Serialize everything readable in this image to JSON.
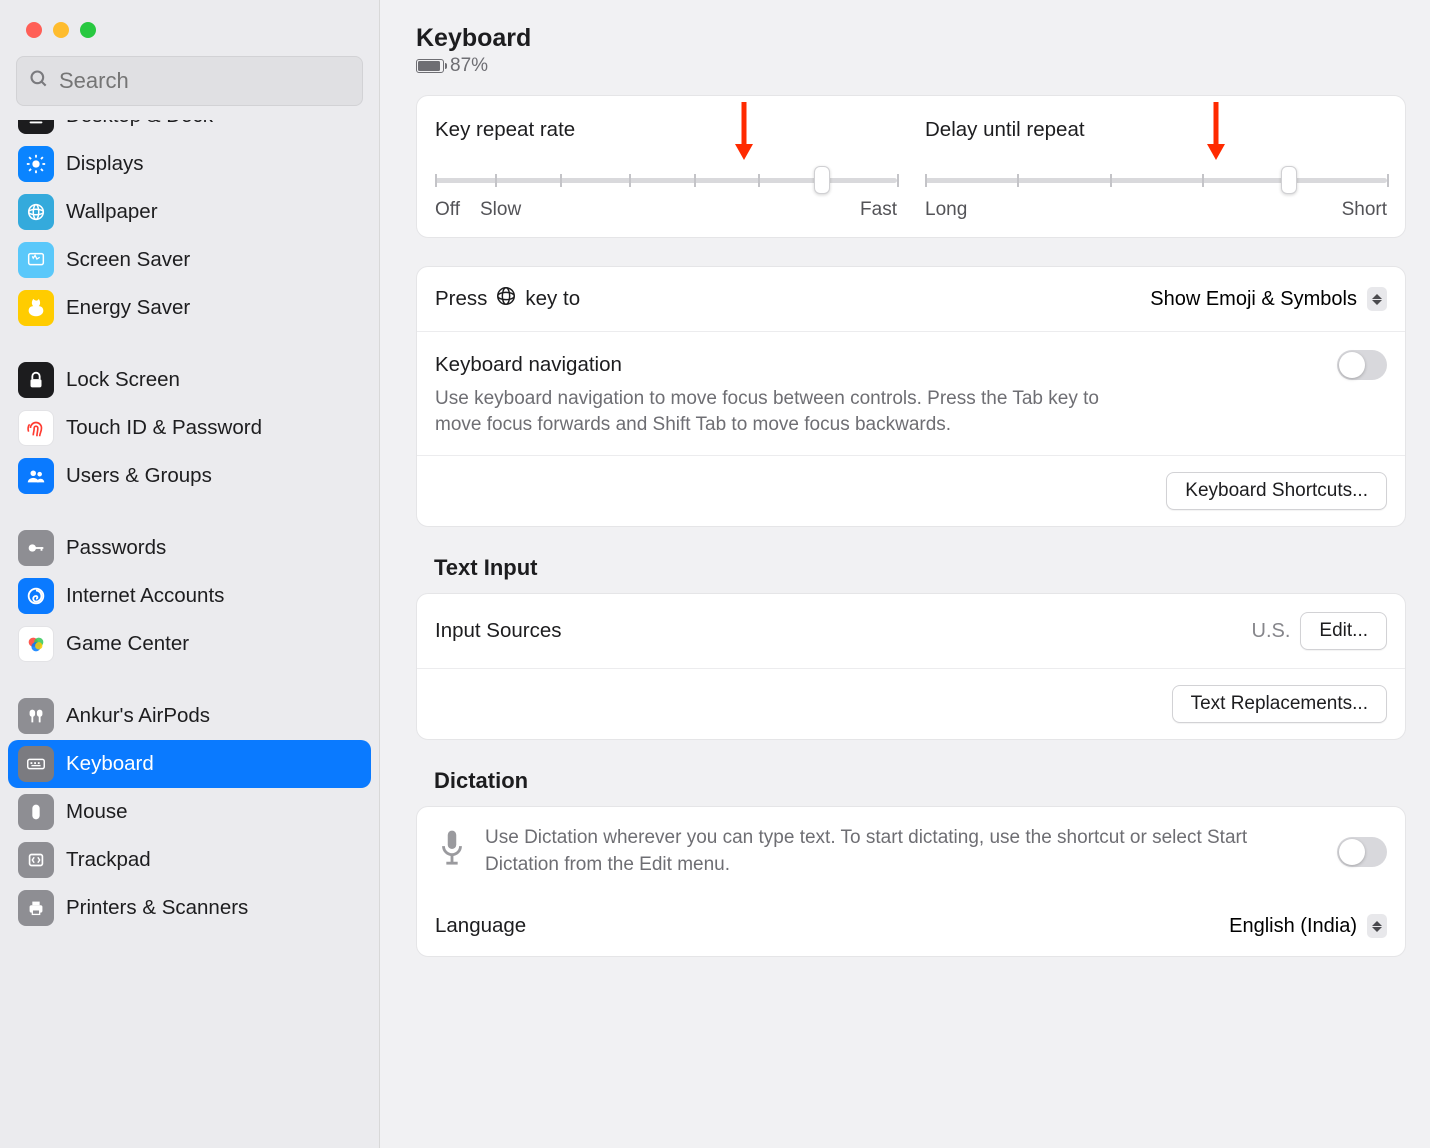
{
  "header": {
    "title": "Keyboard",
    "battery_pct": "87%"
  },
  "search": {
    "placeholder": "Search"
  },
  "sidebar": [
    {
      "id": "desktop-dock",
      "label": "Desktop & Dock",
      "bg": "#1c1c1e",
      "partial": true
    },
    {
      "id": "displays",
      "label": "Displays",
      "bg": "#0a84ff"
    },
    {
      "id": "wallpaper",
      "label": "Wallpaper",
      "bg": "#34aadc"
    },
    {
      "id": "screensaver",
      "label": "Screen Saver",
      "bg": "#5ac8fa"
    },
    {
      "id": "energy",
      "label": "Energy Saver",
      "bg": "#ffcc00"
    }
  ],
  "sidebar2": [
    {
      "id": "lockscreen",
      "label": "Lock Screen",
      "bg": "#1c1c1e"
    },
    {
      "id": "touchid",
      "label": "Touch ID & Password",
      "bg": "#ffffff"
    },
    {
      "id": "usersgroups",
      "label": "Users & Groups",
      "bg": "#0a7aff"
    }
  ],
  "sidebar3": [
    {
      "id": "passwords",
      "label": "Passwords",
      "bg": "#8e8e93"
    },
    {
      "id": "internet",
      "label": "Internet Accounts",
      "bg": "#0a7aff"
    },
    {
      "id": "gamecenter",
      "label": "Game Center",
      "bg": "#ffffff"
    }
  ],
  "sidebar4": [
    {
      "id": "airpods",
      "label": "Ankur's AirPods",
      "bg": "#8e8e93"
    },
    {
      "id": "keyboard",
      "label": "Keyboard",
      "bg": "#8e8e93",
      "selected": true
    },
    {
      "id": "mouse",
      "label": "Mouse",
      "bg": "#8e8e93"
    },
    {
      "id": "trackpad",
      "label": "Trackpad",
      "bg": "#8e8e93"
    },
    {
      "id": "printers",
      "label": "Printers & Scanners",
      "bg": "#8e8e93"
    }
  ],
  "slider1": {
    "title": "Key repeat rate",
    "left1": "Off",
    "left2": "Slow",
    "right": "Fast"
  },
  "slider2": {
    "title": "Delay until repeat",
    "left": "Long",
    "right": "Short"
  },
  "globe": {
    "label_pre": "Press",
    "label_post": "key to",
    "value": "Show Emoji & Symbols"
  },
  "kn": {
    "title": "Keyboard navigation",
    "desc": "Use keyboard navigation to move focus between controls. Press the Tab key to move focus forwards and Shift Tab to move focus backwards."
  },
  "kbd_shortcuts_btn": "Keyboard Shortcuts...",
  "text_input": {
    "title": "Text Input",
    "row_label": "Input Sources",
    "row_value": "U.S.",
    "edit_btn": "Edit...",
    "replace_btn": "Text Replacements..."
  },
  "dictation": {
    "title": "Dictation",
    "desc": "Use Dictation wherever you can type text. To start dictating, use the shortcut or select Start Dictation from the Edit menu.",
    "lang_label": "Language",
    "lang_value": "English (India)"
  }
}
